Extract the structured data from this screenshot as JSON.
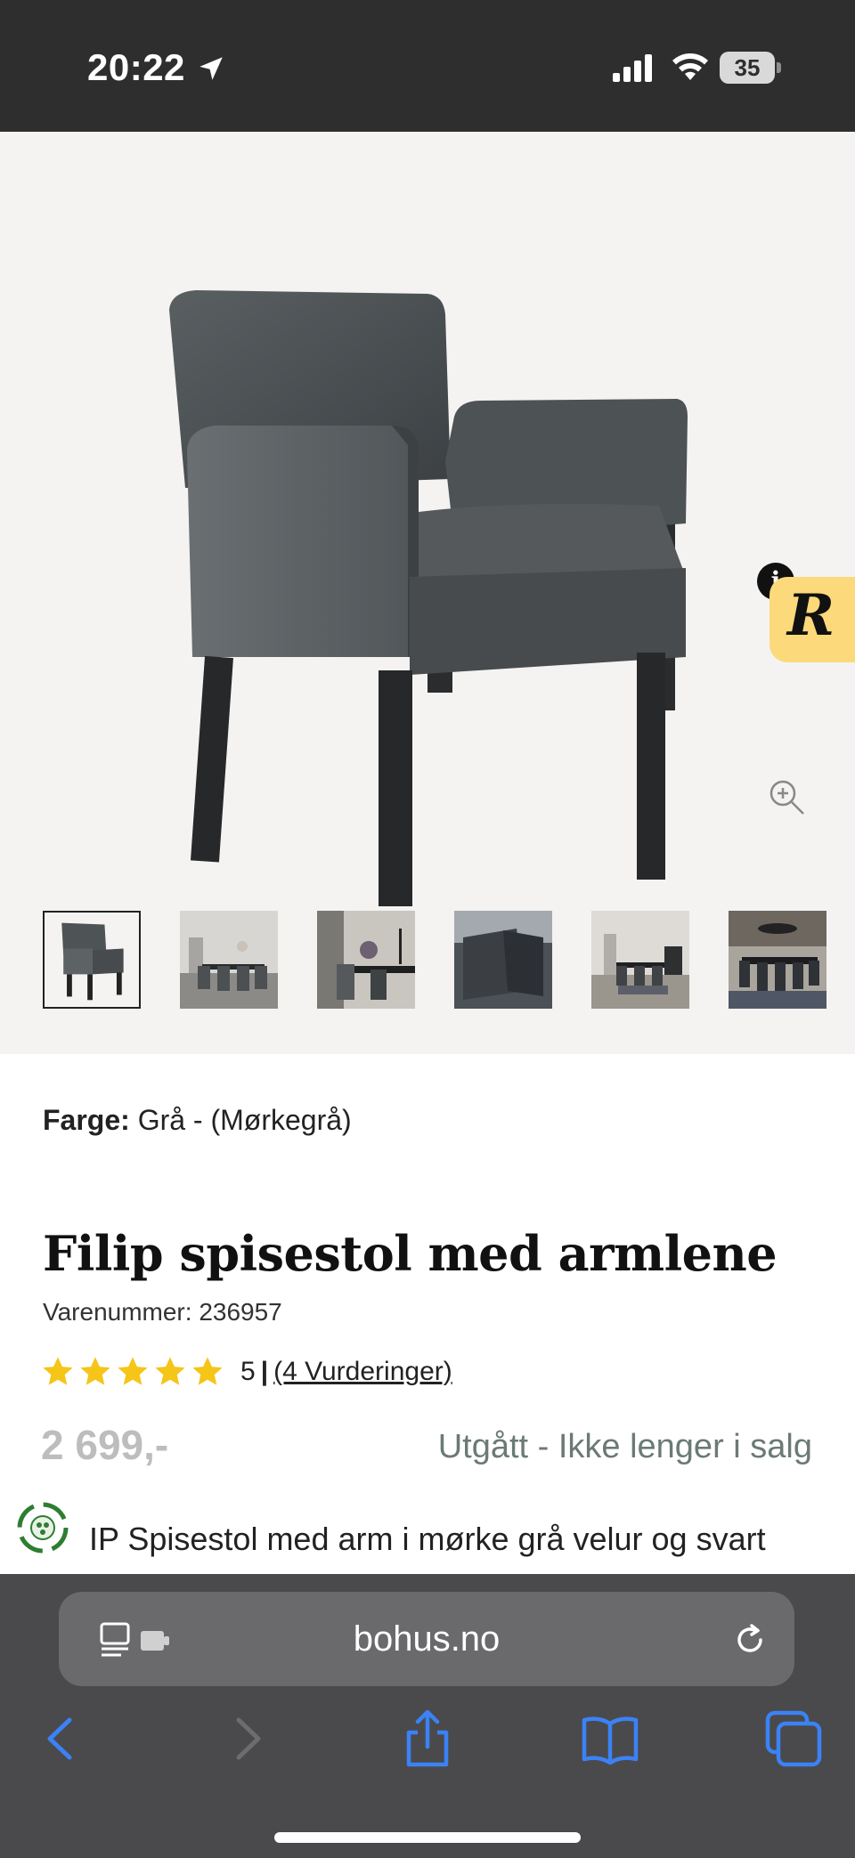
{
  "status_bar": {
    "time": "20:22",
    "battery": "35"
  },
  "gallery": {
    "thumbnails": [
      "Stol",
      "Spisestue 1",
      "Spisestue 2",
      "Detalj",
      "Spisestue 3",
      "Spisestue 4"
    ],
    "active_index": 0,
    "badge_letter": "R",
    "info_letter": "i"
  },
  "product": {
    "color_label": "Farge:",
    "color_value": "Grå - (Mørkegrå)",
    "title": "Filip spisestol med armlene",
    "sku": "Varenummer: 236957",
    "rating_value": 5,
    "rating_score": "5",
    "rating_separator": "|",
    "rating_count": "(4 Vurderinger)",
    "price": "2 699,-",
    "availability": "Utgått - Ikke lenger i salg",
    "description": "IP Spisestol med arm i mørke grå velur og svart"
  },
  "browser": {
    "url": "bohus.no"
  },
  "colors": {
    "status_bg": "#2e2e2f",
    "gallery_bg": "#f4f3f2",
    "badge_yellow": "#fcd97a",
    "star_yellow": "#f5c518",
    "ios_blue": "#3b82f6",
    "browser_bg": "#4a4a4c"
  }
}
